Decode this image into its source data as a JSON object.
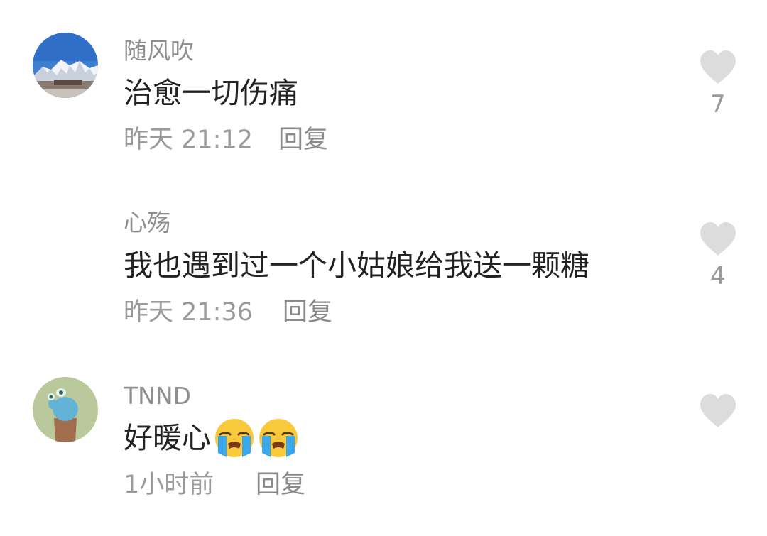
{
  "comments": [
    {
      "username": "随风吹",
      "text": "治愈一切伤痛",
      "time": "昨天 21:12",
      "reply": "回复",
      "likes": "7",
      "avatar_icon": "snowy-mountain-avatar"
    },
    {
      "username": "心殇",
      "text": "我也遇到过一个小姑娘给我送一颗糖",
      "time": "昨天 21:36",
      "reply": "回复",
      "likes": "4"
    },
    {
      "username": "TNND",
      "text": "好暖心",
      "emojis": [
        "loudly-crying-face-emoji",
        "loudly-crying-face-emoji"
      ],
      "time": "1小时前",
      "reply": "回复",
      "likes": "",
      "avatar_icon": "cactus-avatar"
    }
  ],
  "colors": {
    "username": "#8e8e8e",
    "text": "#222222",
    "meta": "#9a9a9a",
    "heart": "#dcdcdc"
  }
}
